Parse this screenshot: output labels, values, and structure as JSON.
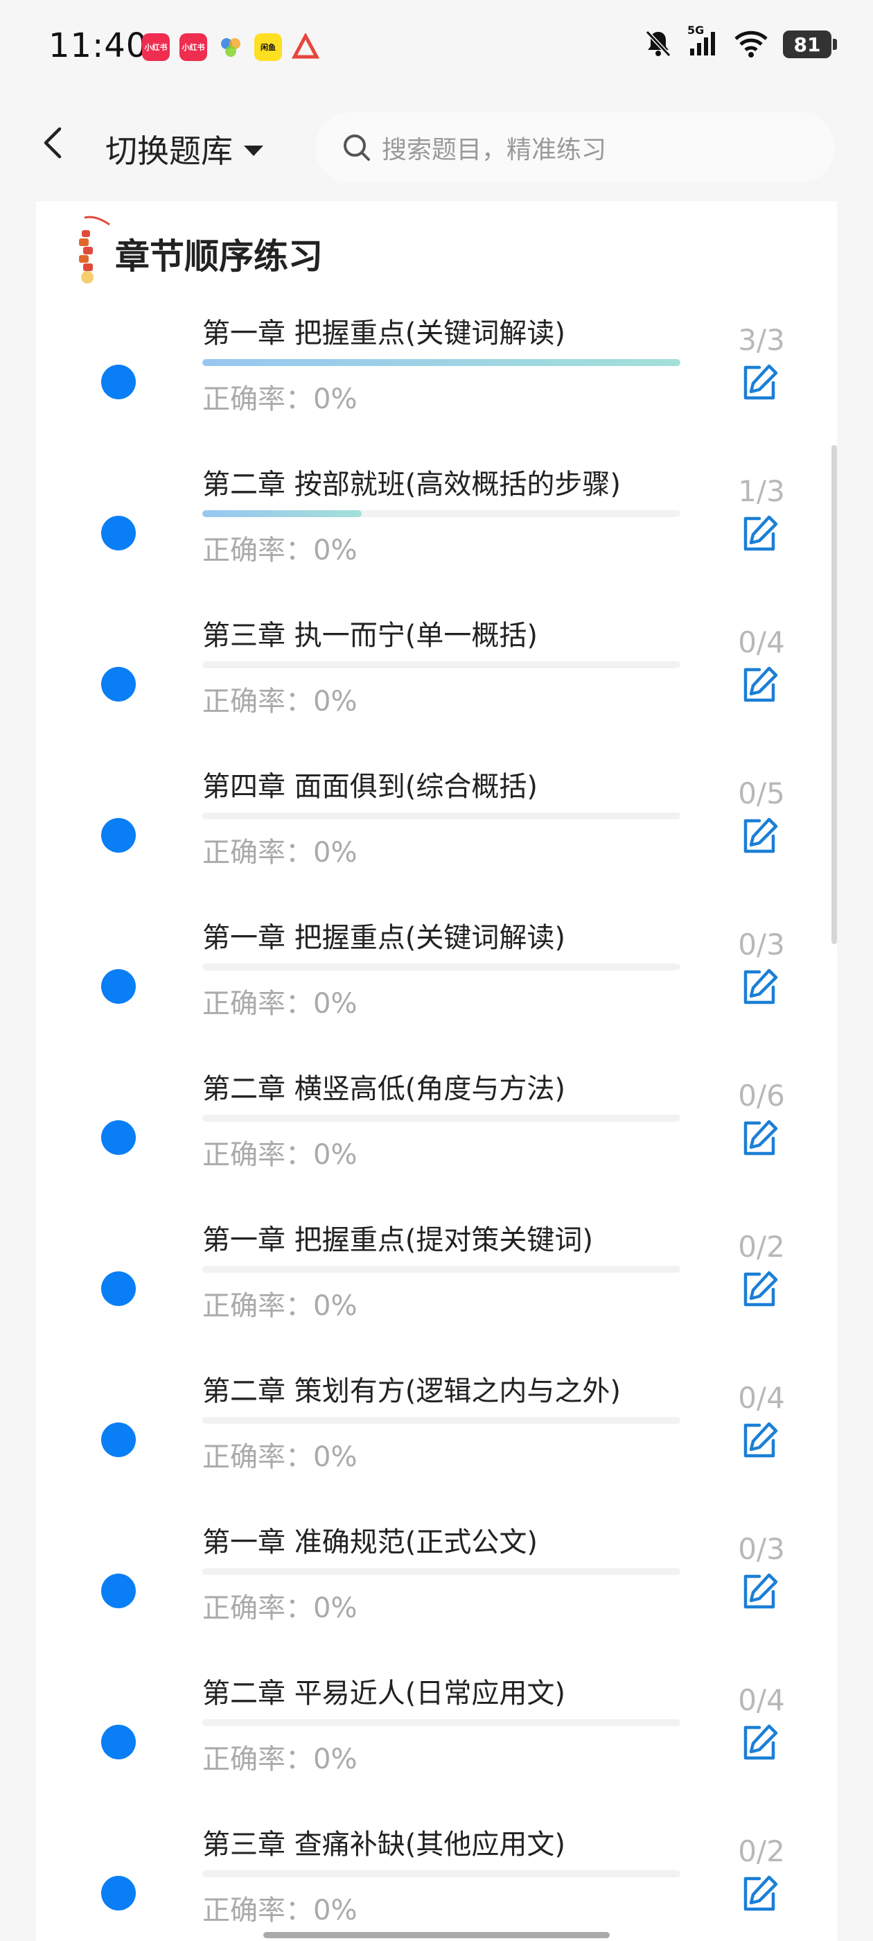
{
  "status": {
    "time": "11:40",
    "apps": [
      {
        "label": "小红书",
        "color": "#ef2d4f"
      },
      {
        "label": "小红书",
        "color": "#ef2d4f"
      },
      {
        "label": "",
        "color": "#ffffff"
      },
      {
        "label": "闲鱼",
        "color": "#ffdf21"
      },
      {
        "label": "",
        "color": "#ffffff"
      }
    ],
    "network": "5G",
    "battery": "81"
  },
  "header": {
    "switch_label": "切换题库",
    "search_placeholder": "搜索题目，精准练习"
  },
  "section": {
    "title": "章节顺序练习"
  },
  "chapters": [
    {
      "title": "第一章 把握重点(关键词解读)",
      "accuracy": "正确率：0%",
      "count": "3/3",
      "progress": 1.0
    },
    {
      "title": "第二章 按部就班(高效概括的步骤)",
      "accuracy": "正确率：0%",
      "count": "1/3",
      "progress": 0.333
    },
    {
      "title": "第三章 执一而宁(单一概括)",
      "accuracy": "正确率：0%",
      "count": "0/4",
      "progress": 0
    },
    {
      "title": "第四章 面面俱到(综合概括)",
      "accuracy": "正确率：0%",
      "count": "0/5",
      "progress": 0
    },
    {
      "title": "第一章 把握重点(关键词解读)",
      "accuracy": "正确率：0%",
      "count": "0/3",
      "progress": 0
    },
    {
      "title": "第二章 横竖高低(角度与方法)",
      "accuracy": "正确率：0%",
      "count": "0/6",
      "progress": 0
    },
    {
      "title": "第一章 把握重点(提对策关键词)",
      "accuracy": "正确率：0%",
      "count": "0/2",
      "progress": 0
    },
    {
      "title": "第二章 策划有方(逻辑之内与之外)",
      "accuracy": "正确率：0%",
      "count": "0/4",
      "progress": 0
    },
    {
      "title": "第一章 准确规范(正式公文)",
      "accuracy": "正确率：0%",
      "count": "0/3",
      "progress": 0
    },
    {
      "title": "第二章 平易近人(日常应用文)",
      "accuracy": "正确率：0%",
      "count": "0/4",
      "progress": 0
    },
    {
      "title": "第三章 查痛补缺(其他应用文)",
      "accuracy": "正确率：0%",
      "count": "0/2",
      "progress": 0
    }
  ],
  "colors": {
    "dot": "#0a7ef5",
    "edit_icon": "#1b7fd6"
  }
}
